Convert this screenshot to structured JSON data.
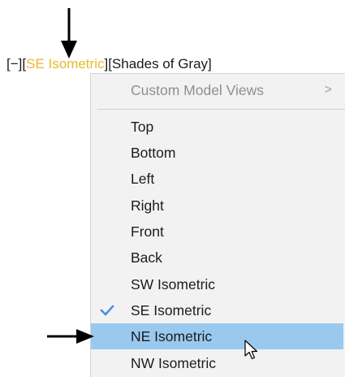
{
  "viewport_controls": {
    "minus": "[−]",
    "view_open": "[",
    "view_name": "SE Isometric",
    "view_close": "]",
    "visual_style": "[Shades of Gray]"
  },
  "menu": {
    "header_item": {
      "label": "Custom Model Views",
      "submenu_indicator": ">"
    },
    "items": [
      {
        "label": "Top"
      },
      {
        "label": "Bottom"
      },
      {
        "label": "Left"
      },
      {
        "label": "Right"
      },
      {
        "label": "Front"
      },
      {
        "label": "Back"
      },
      {
        "label": "SW Isometric"
      },
      {
        "label": "SE Isometric",
        "checked": true
      },
      {
        "label": "NE Isometric",
        "highlighted": true
      },
      {
        "label": "NW Isometric"
      }
    ]
  },
  "colors": {
    "accent_text": "#e8b92b",
    "highlight": "#99c9ef",
    "checkmark": "#4a8fd8",
    "menu_background": "#f2f2f2"
  },
  "icons": [
    "down-arrow-icon",
    "right-arrow-icon",
    "checkmark-icon",
    "mouse-cursor-icon"
  ]
}
